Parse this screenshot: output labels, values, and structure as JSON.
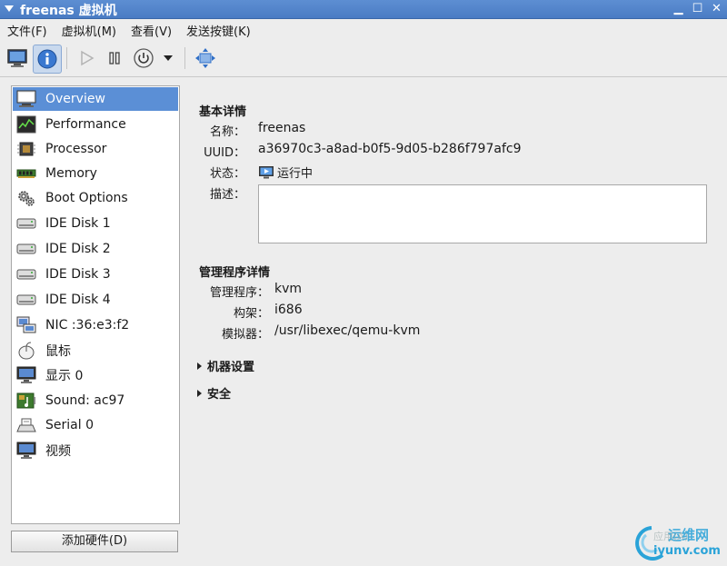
{
  "window": {
    "title": "freenas 虚拟机"
  },
  "menu": [
    "文件(F)",
    "虚拟机(M)",
    "查看(V)",
    "发送按键(K)"
  ],
  "toolbar": {
    "buttons": [
      "console-icon",
      "info-icon",
      "run-icon",
      "pause-icon",
      "power-icon",
      "dropdown-arrow-icon",
      "fullscreen-icon"
    ]
  },
  "sidebar": {
    "items": [
      {
        "label": "Overview",
        "icon": "monitor-icon",
        "selected": true
      },
      {
        "label": "Performance",
        "icon": "performance-icon"
      },
      {
        "label": "Processor",
        "icon": "processor-icon"
      },
      {
        "label": "Memory",
        "icon": "memory-icon"
      },
      {
        "label": "Boot Options",
        "icon": "gears-icon"
      },
      {
        "label": "IDE Disk 1",
        "icon": "disk-icon"
      },
      {
        "label": "IDE Disk 2",
        "icon": "disk-icon"
      },
      {
        "label": "IDE Disk 3",
        "icon": "disk-icon"
      },
      {
        "label": "IDE Disk 4",
        "icon": "disk-icon"
      },
      {
        "label": "NIC :36:e3:f2",
        "icon": "network-icon"
      },
      {
        "label": "鼠标",
        "icon": "mouse-icon"
      },
      {
        "label": "显示 0",
        "icon": "display-icon"
      },
      {
        "label": "Sound: ac97",
        "icon": "sound-icon"
      },
      {
        "label": "Serial 0",
        "icon": "serial-icon"
      },
      {
        "label": "视频",
        "icon": "video-icon"
      }
    ],
    "add_hardware": "添加硬件(D)"
  },
  "details": {
    "basic_title": "基本详情",
    "name_label": "名称：",
    "name_value": "freenas",
    "uuid_label": "UUID：",
    "uuid_value": "a36970c3-a8ad-b0f5-9d05-b286f797afc9",
    "status_label": "状态：",
    "status_value": "运行中",
    "desc_label": "描述：",
    "desc_value": "",
    "hv_title": "管理程序详情",
    "hv_label": "管理程序：",
    "hv_value": "kvm",
    "arch_label": "构架：",
    "arch_value": "i686",
    "emu_label": "模拟器：",
    "emu_value": "/usr/libexec/qemu-kvm",
    "machine_settings": "机器设置",
    "security": "安全"
  },
  "watermark": {
    "line1": "运维网",
    "line2": "iyunv.com",
    "faded": "应用(A)"
  },
  "colors": {
    "titlebar": "#4a7cc4",
    "selection": "#5b8fd6",
    "accent": "#2f6fc7"
  }
}
